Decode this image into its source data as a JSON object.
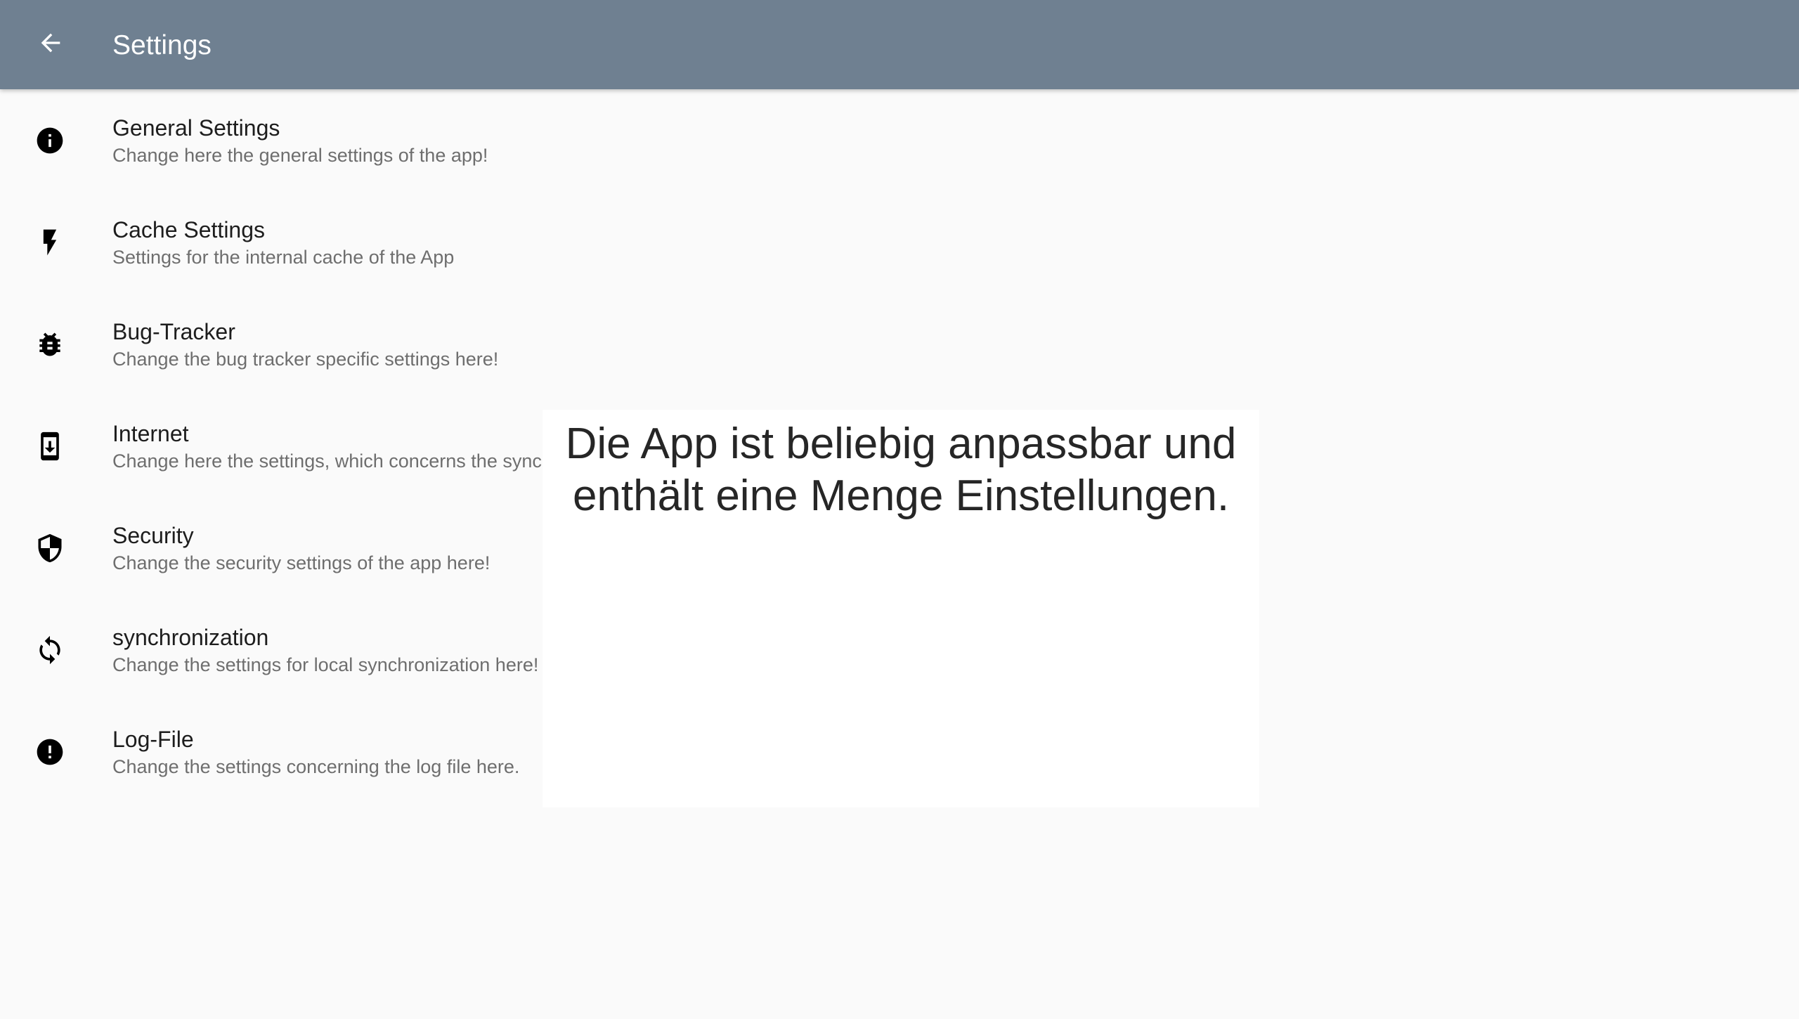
{
  "app_bar": {
    "title": "Settings",
    "back_icon": "arrow-left-icon",
    "background_color": "#6f8091"
  },
  "settings": {
    "items": [
      {
        "title": "General Settings",
        "subtitle": "Change here the general settings of the app!",
        "icon": "info-icon"
      },
      {
        "title": "Cache Settings",
        "subtitle": "Settings for the internal cache of the App",
        "icon": "flash-icon"
      },
      {
        "title": "Bug-Tracker",
        "subtitle": "Change the bug tracker specific settings here!",
        "icon": "bug-icon"
      },
      {
        "title": "Internet",
        "subtitle": "Change here the settings, which concerns the synchronization with the internet.",
        "icon": "phone-download-icon"
      },
      {
        "title": "Security",
        "subtitle": "Change the security settings of the app here!",
        "icon": "shield-icon"
      },
      {
        "title": "synchronization",
        "subtitle": "Change the settings for local synchronization here!",
        "icon": "sync-icon"
      },
      {
        "title": "Log-File",
        "subtitle": "Change the settings concerning the log file here.",
        "icon": "alert-circle-icon"
      }
    ]
  },
  "overlay": {
    "caption": "Die App ist beliebig anpassbar und enthält eine Menge Einstellungen."
  }
}
